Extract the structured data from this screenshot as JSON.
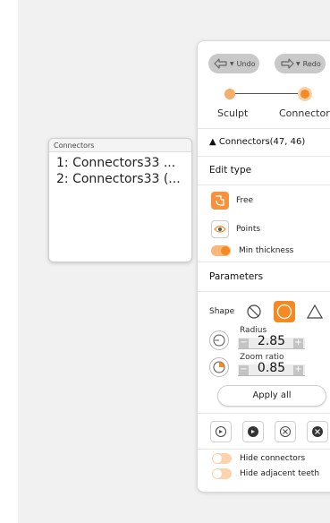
{
  "connectors_window": {
    "title": "Connectors",
    "items": [
      {
        "label": "1: Connectors33 ..."
      },
      {
        "label": "2: Connectors33 (..."
      }
    ]
  },
  "toolbar": {
    "undo_label": "Undo",
    "redo_label": "Redo"
  },
  "steps": [
    {
      "label": "Sculpt",
      "state": "done"
    },
    {
      "label": "Connectors",
      "state": "active"
    }
  ],
  "connectors_header": "▲ Connectors(47, 46)",
  "edit_type": {
    "title": "Edit type",
    "options": [
      {
        "label": "Free",
        "icon": "free-draw-icon",
        "selected": true
      },
      {
        "label": "Points",
        "icon": "points-icon",
        "selected": false
      }
    ],
    "min_thickness": {
      "label": "Min thickness",
      "on": true
    }
  },
  "parameters": {
    "title": "Parameters",
    "shape_label": "Shape",
    "shapes": [
      {
        "icon": "no-shape-icon",
        "selected": false
      },
      {
        "icon": "circle-shape-icon",
        "selected": true
      },
      {
        "icon": "triangle-shape-icon",
        "selected": false
      }
    ],
    "radius": {
      "label": "Radius",
      "value": "2.85"
    },
    "zoom_ratio": {
      "label": "Zoom ratio",
      "value": "0.85"
    },
    "apply_all_label": "Apply all"
  },
  "tools": [
    "rotate-icon",
    "rotate-filled-icon",
    "clear-icon",
    "delete-icon"
  ],
  "toggles": [
    {
      "label": "Hide connectors",
      "on": false
    },
    {
      "label": "Hide adjacent teeth",
      "on": false
    }
  ],
  "colors": {
    "accent": "#f58a25",
    "accent_light": "#f8b878",
    "panel_bg": "#ffffff",
    "background": "#f1f1f1"
  }
}
